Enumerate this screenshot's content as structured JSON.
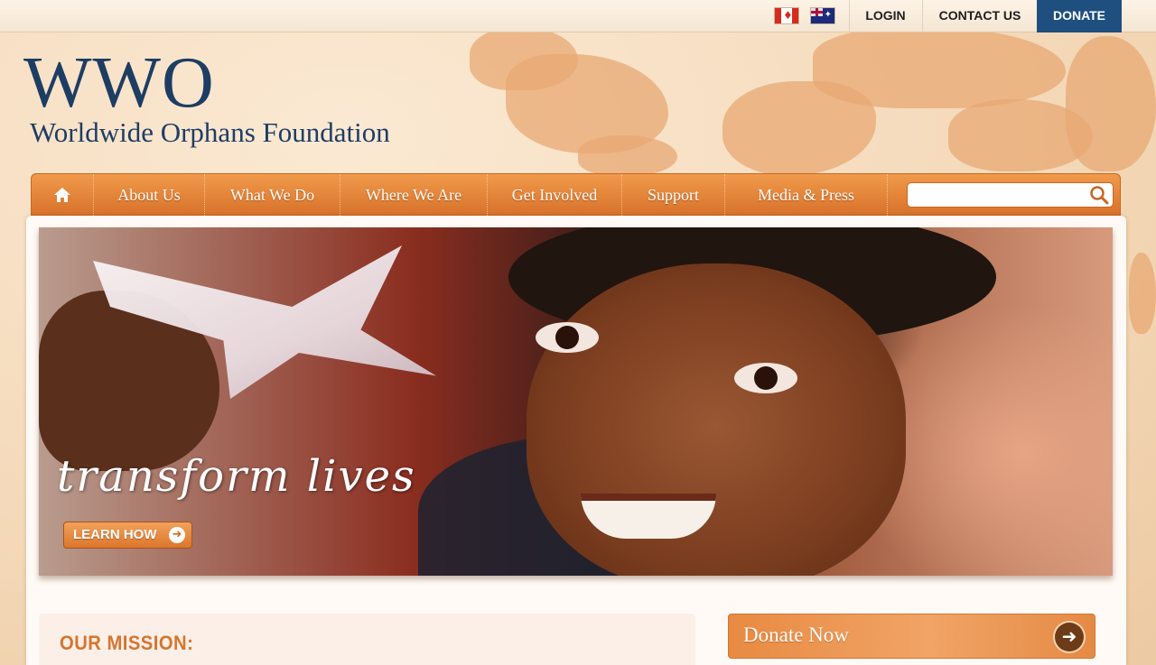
{
  "topbar": {
    "flags": [
      {
        "name": "canada-flag-icon",
        "label": "Canada"
      },
      {
        "name": "australia-flag-icon",
        "label": "Australia"
      }
    ],
    "login_label": "LOGIN",
    "contact_label": "CONTACT US",
    "donate_label": "DONATE"
  },
  "logo": {
    "mark": "WWO",
    "tagline": "Worldwide Orphans Foundation"
  },
  "nav": {
    "home_icon": "home-icon",
    "items": [
      {
        "label": "About Us"
      },
      {
        "label": "What We Do"
      },
      {
        "label": "Where We Are"
      },
      {
        "label": "Get Involved"
      },
      {
        "label": "Support"
      },
      {
        "label": "Media & Press"
      }
    ],
    "search": {
      "value": "",
      "placeholder": ""
    },
    "search_icon": "search-icon"
  },
  "hero": {
    "headline": "transform lives",
    "cta_label": "LEARN HOW",
    "cta_icon": "arrow-right-icon"
  },
  "mission": {
    "title": "OUR MISSION:"
  },
  "donate_box": {
    "label": "Donate Now",
    "icon": "arrow-right-circle-icon"
  },
  "colors": {
    "accent_orange": "#e0782e",
    "brand_navy": "#1d3d63",
    "donate_blue": "#1f4f7f",
    "mission_title": "#d5762f"
  }
}
